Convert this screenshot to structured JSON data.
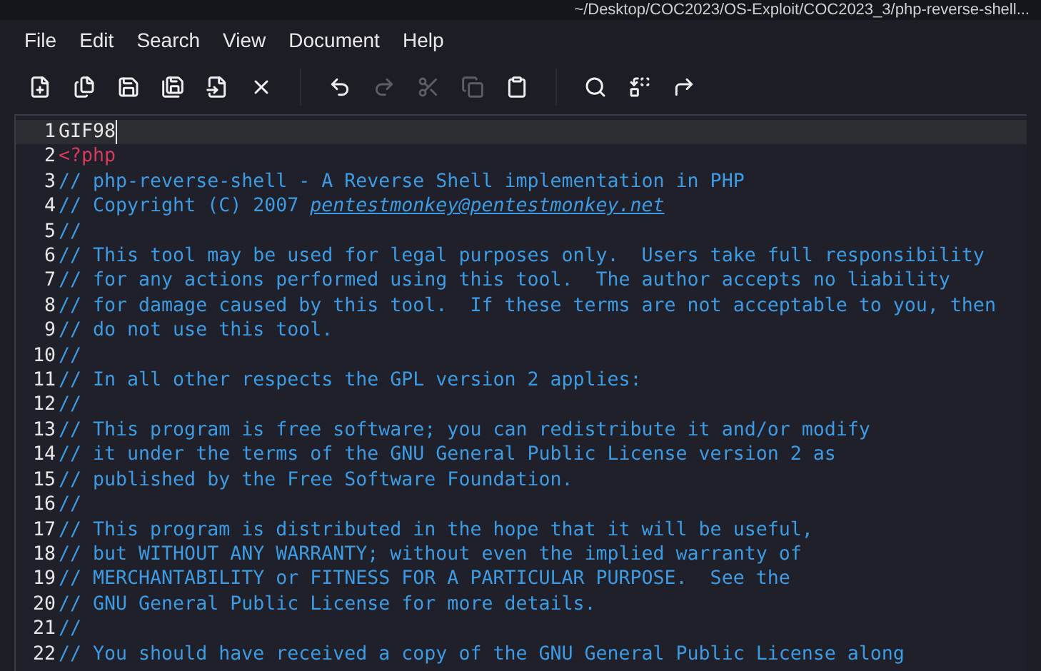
{
  "window": {
    "title": "~/Desktop/COC2023/OS-Exploit/COC2023_3/php-reverse-shell..."
  },
  "menu": [
    "File",
    "Edit",
    "Search",
    "View",
    "Document",
    "Help"
  ],
  "toolbar": [
    [
      {
        "disabled": false
      },
      {
        "disabled": false
      },
      {
        "disabled": false
      },
      {
        "disabled": false
      },
      {
        "disabled": false
      },
      {
        "disabled": false
      }
    ],
    [
      {
        "disabled": false
      },
      {
        "disabled": true
      },
      {
        "disabled": true
      },
      {
        "disabled": true
      },
      {
        "disabled": false
      }
    ],
    [
      {
        "disabled": false
      },
      {
        "disabled": false
      },
      {
        "disabled": false
      }
    ]
  ],
  "editor": {
    "lines": [
      {
        "number": "1",
        "current": true,
        "segments": [
          {
            "kind": "plain",
            "text": "GIF98"
          }
        ]
      },
      {
        "number": "2",
        "current": false,
        "segments": [
          {
            "kind": "tag",
            "text": "<?php"
          }
        ]
      },
      {
        "number": "3",
        "current": false,
        "segments": [
          {
            "kind": "comment",
            "text": "// php-reverse-shell - A Reverse Shell implementation in PHP"
          }
        ]
      },
      {
        "number": "4",
        "current": false,
        "segments": [
          {
            "kind": "comment",
            "text": "// Copyright (C) 2007 "
          },
          {
            "kind": "link",
            "text": "pentestmonkey@pentestmonkey.net"
          }
        ]
      },
      {
        "number": "5",
        "current": false,
        "segments": [
          {
            "kind": "comment",
            "text": "//"
          }
        ]
      },
      {
        "number": "6",
        "current": false,
        "segments": [
          {
            "kind": "comment",
            "text": "// This tool may be used for legal purposes only.  Users take full responsibility"
          }
        ]
      },
      {
        "number": "7",
        "current": false,
        "segments": [
          {
            "kind": "comment",
            "text": "// for any actions performed using this tool.  The author accepts no liability"
          }
        ]
      },
      {
        "number": "8",
        "current": false,
        "segments": [
          {
            "kind": "comment",
            "text": "// for damage caused by this tool.  If these terms are not acceptable to you, then"
          }
        ]
      },
      {
        "number": "9",
        "current": false,
        "segments": [
          {
            "kind": "comment",
            "text": "// do not use this tool."
          }
        ]
      },
      {
        "number": "10",
        "current": false,
        "segments": [
          {
            "kind": "comment",
            "text": "//"
          }
        ]
      },
      {
        "number": "11",
        "current": false,
        "segments": [
          {
            "kind": "comment",
            "text": "// In all other respects the GPL version 2 applies:"
          }
        ]
      },
      {
        "number": "12",
        "current": false,
        "segments": [
          {
            "kind": "comment",
            "text": "//"
          }
        ]
      },
      {
        "number": "13",
        "current": false,
        "segments": [
          {
            "kind": "comment",
            "text": "// This program is free software; you can redistribute it and/or modify"
          }
        ]
      },
      {
        "number": "14",
        "current": false,
        "segments": [
          {
            "kind": "comment",
            "text": "// it under the terms of the GNU General Public License version 2 as"
          }
        ]
      },
      {
        "number": "15",
        "current": false,
        "segments": [
          {
            "kind": "comment",
            "text": "// published by the Free Software Foundation."
          }
        ]
      },
      {
        "number": "16",
        "current": false,
        "segments": [
          {
            "kind": "comment",
            "text": "//"
          }
        ]
      },
      {
        "number": "17",
        "current": false,
        "segments": [
          {
            "kind": "comment",
            "text": "// This program is distributed in the hope that it will be useful,"
          }
        ]
      },
      {
        "number": "18",
        "current": false,
        "segments": [
          {
            "kind": "comment",
            "text": "// but WITHOUT ANY WARRANTY; without even the implied warranty of"
          }
        ]
      },
      {
        "number": "19",
        "current": false,
        "segments": [
          {
            "kind": "comment",
            "text": "// MERCHANTABILITY or FITNESS FOR A PARTICULAR PURPOSE.  See the"
          }
        ]
      },
      {
        "number": "20",
        "current": false,
        "segments": [
          {
            "kind": "comment",
            "text": "// GNU General Public License for more details."
          }
        ]
      },
      {
        "number": "21",
        "current": false,
        "segments": [
          {
            "kind": "comment",
            "text": "//"
          }
        ]
      },
      {
        "number": "22",
        "current": false,
        "segments": [
          {
            "kind": "comment",
            "text": "// You should have received a copy of the GNU General Public License along"
          }
        ]
      }
    ]
  }
}
